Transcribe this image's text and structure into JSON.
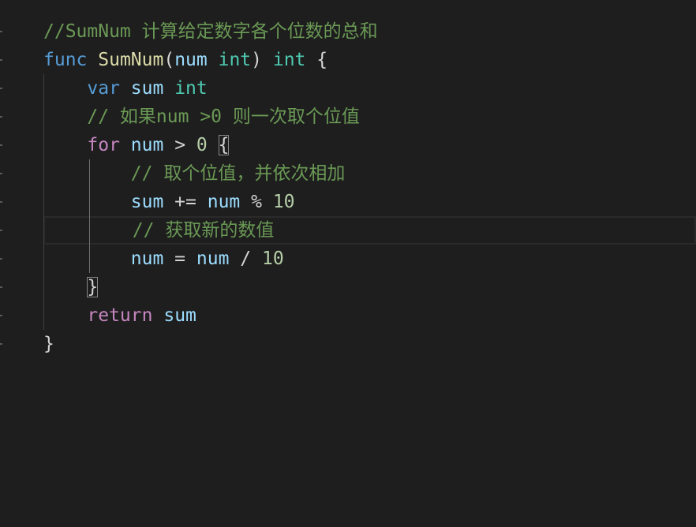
{
  "editor": {
    "language": "go",
    "current_line": 8,
    "colors": {
      "comment": "#6a9955",
      "keyword": "#569cd6",
      "func": "#dcdcaa",
      "var": "#9cdcfe",
      "type": "#4ec9b0",
      "control": "#c586c0",
      "number": "#b5cea8",
      "text": "#d4d4d4"
    },
    "lines": [
      [
        [
          "comment",
          "//SumNum 计算给定数字各个位数的总和"
        ]
      ],
      [
        [
          "keyword",
          "func"
        ],
        [
          "text",
          " "
        ],
        [
          "func",
          "SumNum"
        ],
        [
          "text",
          "("
        ],
        [
          "var",
          "num"
        ],
        [
          "text",
          " "
        ],
        [
          "type",
          "int"
        ],
        [
          "text",
          ") "
        ],
        [
          "type",
          "int"
        ],
        [
          "text",
          " {"
        ]
      ],
      [
        [
          "text",
          "    "
        ],
        [
          "keyword",
          "var"
        ],
        [
          "text",
          " "
        ],
        [
          "var",
          "sum"
        ],
        [
          "text",
          " "
        ],
        [
          "type",
          "int"
        ]
      ],
      [
        [
          "text",
          "    "
        ],
        [
          "comment",
          "// 如果num >0 则一次取个位值"
        ]
      ],
      [
        [
          "text",
          "    "
        ],
        [
          "control",
          "for"
        ],
        [
          "text",
          " "
        ],
        [
          "var",
          "num"
        ],
        [
          "text",
          " > "
        ],
        [
          "number",
          "0"
        ],
        [
          "text",
          " "
        ],
        [
          "bracket",
          "{"
        ]
      ],
      [
        [
          "text",
          "        "
        ],
        [
          "comment",
          "// 取个位值，并依次相加"
        ]
      ],
      [
        [
          "text",
          "        "
        ],
        [
          "var",
          "sum"
        ],
        [
          "text",
          " += "
        ],
        [
          "var",
          "num"
        ],
        [
          "text",
          " % "
        ],
        [
          "number",
          "10"
        ]
      ],
      [
        [
          "text",
          "        "
        ],
        [
          "comment",
          "// 获取新的数值"
        ]
      ],
      [
        [
          "text",
          "        "
        ],
        [
          "var",
          "num"
        ],
        [
          "text",
          " = "
        ],
        [
          "var",
          "num"
        ],
        [
          "text",
          " / "
        ],
        [
          "number",
          "10"
        ]
      ],
      [
        [
          "text",
          "    "
        ],
        [
          "bracket",
          "}"
        ]
      ],
      [
        [
          "text",
          "    "
        ],
        [
          "control",
          "return"
        ],
        [
          "text",
          " "
        ],
        [
          "var",
          "sum"
        ]
      ],
      [
        [
          "text",
          "}"
        ]
      ]
    ]
  }
}
